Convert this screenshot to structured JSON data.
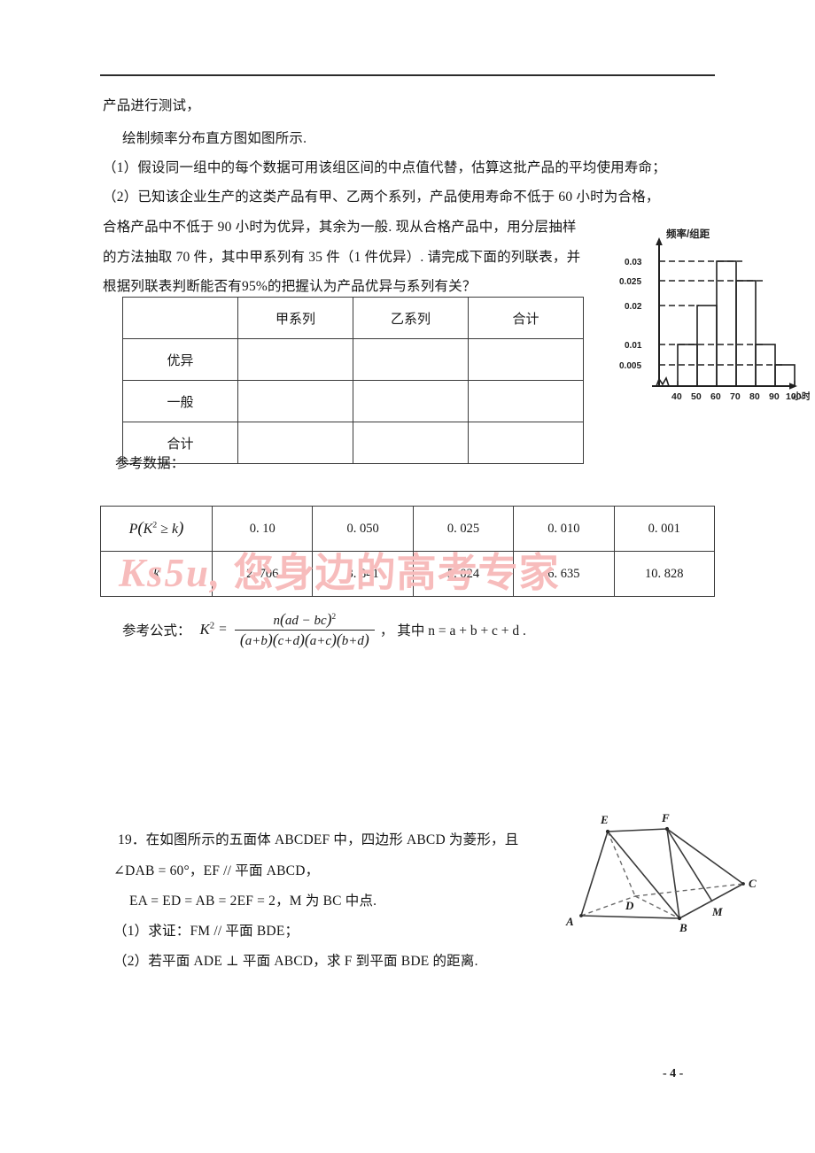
{
  "document": {
    "page_number": "- 4 -",
    "watermark": {
      "latin": "Ks5u,",
      "chinese": "您身边的高考专家"
    }
  },
  "problem18": {
    "lines": [
      "产品进行测试，",
      "绘制频率分布直方图如图所示.",
      "（1）假设同一组中的每个数据可用该组区间的中点值代替，估算这批产品的平均使用寿命；",
      "（2）已知该企业生产的这类产品有甲、乙两个系列，产品使用寿命不低于 60 小时为合格，",
      "合格产品中不低于 90 小时为优异，其余为一般. 现从合格产品中，用分层抽样",
      "的方法抽取 70 件，其中甲系列有 35 件（1 件优异）. 请完成下面的列联表，并",
      "根据列联表判断能否有95%的把握认为产品优异与系列有关？"
    ],
    "contingency_table": {
      "columns": [
        "",
        "甲系列",
        "乙系列",
        "合计"
      ],
      "rows": [
        {
          "label": "优异",
          "cells": [
            "",
            "",
            ""
          ]
        },
        {
          "label": "一般",
          "cells": [
            "",
            "",
            ""
          ]
        },
        {
          "label": "合计",
          "cells": [
            "",
            "",
            ""
          ]
        }
      ]
    },
    "reference_data_label": "参考数据：",
    "reference_table": {
      "row1_header": "P(K² ≥ k)",
      "row1_values": [
        "0. 10",
        "0. 050",
        "0. 025",
        "0. 010",
        "0. 001"
      ],
      "row2_header": "k",
      "row2_values": [
        "2. 706",
        "3. 841",
        "5. 024",
        "6. 635",
        "10. 828"
      ]
    },
    "formula": {
      "label": "参考公式：",
      "lhs": "K",
      "lhs_sup": "2",
      "equals": "=",
      "numerator": "n(ad − bc)",
      "numerator_sup": "2",
      "denominator": "(a+b)(c+d)(a+c)(b+d)",
      "comma": "，",
      "where": "其中 n = a + b + c + d .",
      "plain": "K² = n(ad-bc)² / [(a+b)(c+d)(a+c)(b+d)]"
    }
  },
  "chart_data": {
    "type": "bar",
    "title": "频率/组距",
    "xlabel": "小时",
    "ylabel": "频率/组距",
    "categories": [
      "40-50",
      "50-60",
      "60-70",
      "70-80",
      "80-90",
      "90-100"
    ],
    "bin_edges": [
      40,
      50,
      60,
      70,
      80,
      90,
      100
    ],
    "values": [
      0.01,
      0.02,
      0.03,
      0.025,
      0.01,
      0.005
    ],
    "xticks": [
      "40",
      "50",
      "60",
      "70",
      "80",
      "90",
      "100"
    ],
    "yticks": [
      "0.005",
      "0.01",
      "0.02",
      "0.025",
      "0.03"
    ],
    "ytick_values": [
      0.005,
      0.01,
      0.02,
      0.025,
      0.03
    ],
    "ylim": [
      0,
      0.034
    ],
    "xlim": [
      30,
      108
    ],
    "grid": "dashed-horizontal-guides",
    "legend": "none",
    "axis_break": "y-axis zigzag break near origin"
  },
  "problem19": {
    "lines": [
      "19．在如图所示的五面体 ABCDEF 中，四边形 ABCD 为菱形，且",
      "∠DAB = 60°，EF // 平面 ABCD，",
      "EA = ED = AB = 2EF = 2，M 为 BC 中点.",
      "（1）求证：FM // 平面 BDE；",
      "（2）若平面 ADE ⊥ 平面 ABCD，求 F 到平面 BDE 的距离."
    ],
    "figure": {
      "vertices": [
        "A",
        "B",
        "C",
        "D",
        "E",
        "F",
        "M"
      ],
      "description": "五面体 ABCDEF，底面菱形 ABCD，M 为 BC 中点"
    }
  }
}
